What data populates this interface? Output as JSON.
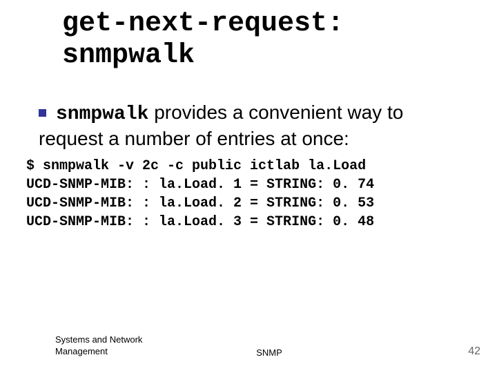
{
  "title": {
    "line1": "get-next-request:",
    "line2": "snmpwalk"
  },
  "bullet": {
    "code_word": "snmpwalk",
    "text_after": " provides a convenient way to request a number of entries at once:"
  },
  "code": {
    "line1": "$ snmpwalk -v 2c -c public ictlab la.Load",
    "line2": "UCD-SNMP-MIB: : la.Load. 1 = STRING: 0. 74",
    "line3": "UCD-SNMP-MIB: : la.Load. 2 = STRING: 0. 53",
    "line4": "UCD-SNMP-MIB: : la.Load. 3 = STRING: 0. 48"
  },
  "footer": {
    "left_line1": "Systems and Network",
    "left_line2": "Management",
    "center": "SNMP",
    "page": "42"
  }
}
